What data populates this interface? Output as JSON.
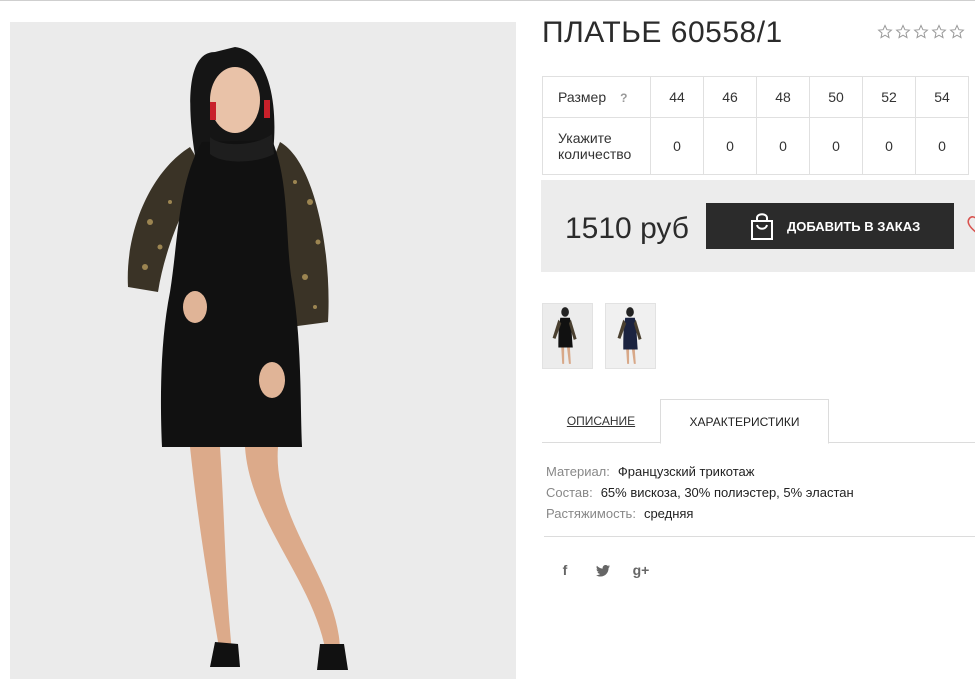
{
  "product": {
    "title": "ПЛАТЬЕ 60558/1",
    "rating_stars": 5,
    "rating_value": 0
  },
  "sizes": {
    "size_label": "Размер",
    "help_mark": "?",
    "qty_label": "Укажите количество",
    "values": [
      "44",
      "46",
      "48",
      "50",
      "52",
      "54"
    ],
    "quantities": [
      "0",
      "0",
      "0",
      "0",
      "0",
      "0"
    ]
  },
  "buy": {
    "price": "1510 руб",
    "add_button": "ДОБАВИТЬ В ЗАКАЗ"
  },
  "tabs": {
    "description": "ОПИСАНИЕ",
    "characteristics": "ХАРАКТЕРИСТИКИ"
  },
  "specs": [
    {
      "key": "Материал:",
      "value": "Французский трикотаж"
    },
    {
      "key": "Состав:",
      "value": "65% вискоза, 30% полиэстер, 5% эластан"
    },
    {
      "key": "Растяжимость:",
      "value": "средняя"
    }
  ],
  "social": {
    "facebook": "f",
    "google": "g+"
  },
  "colors": {
    "button_bg": "#2b2b2b",
    "box_bg": "#ececec",
    "heart": "#d9534f"
  }
}
